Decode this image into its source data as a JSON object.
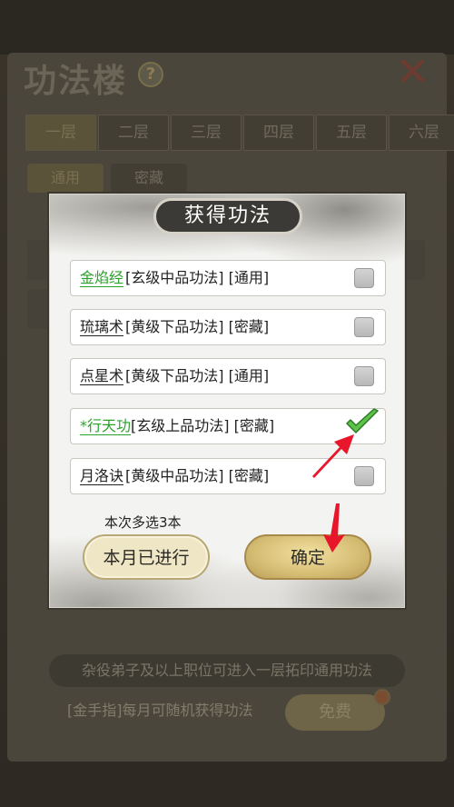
{
  "background": {
    "title": "功法楼",
    "help_icon": "question-icon",
    "close_icon": "close-icon",
    "floor_tabs": [
      "一层",
      "二层",
      "三层",
      "四层",
      "五层",
      "六层"
    ],
    "sub_tabs": [
      "通用",
      "密藏"
    ],
    "info_text": "杂役弟子及以上职位可进入一层拓印通用功法",
    "cheat_text": "[金手指]每月可随机获得功法",
    "free_button": "免费"
  },
  "dialog": {
    "title": "获得功法",
    "skills": [
      {
        "name": "金焰经",
        "tags": "[玄级中品功法] [通用]",
        "highlight": true,
        "checked": false
      },
      {
        "name": "琉璃术",
        "tags": "[黄级下品功法] [密藏]",
        "highlight": false,
        "checked": false
      },
      {
        "name": "点星术",
        "tags": "[黄级下品功法] [通用]",
        "highlight": false,
        "checked": false
      },
      {
        "name": "*行天功",
        "tags": "[玄级上品功法] [密藏]",
        "highlight": true,
        "checked": true
      },
      {
        "name": "月洛诀",
        "tags": "[黄级中品功法] [密藏]",
        "highlight": false,
        "checked": false
      }
    ],
    "multi_note": "本次多选3本",
    "month_button": "本月已进行",
    "confirm_button": "确定"
  },
  "colors": {
    "highlight_green": "#2aa22a",
    "arrow_red": "#e8162a",
    "check_green": "#5cc24a"
  }
}
